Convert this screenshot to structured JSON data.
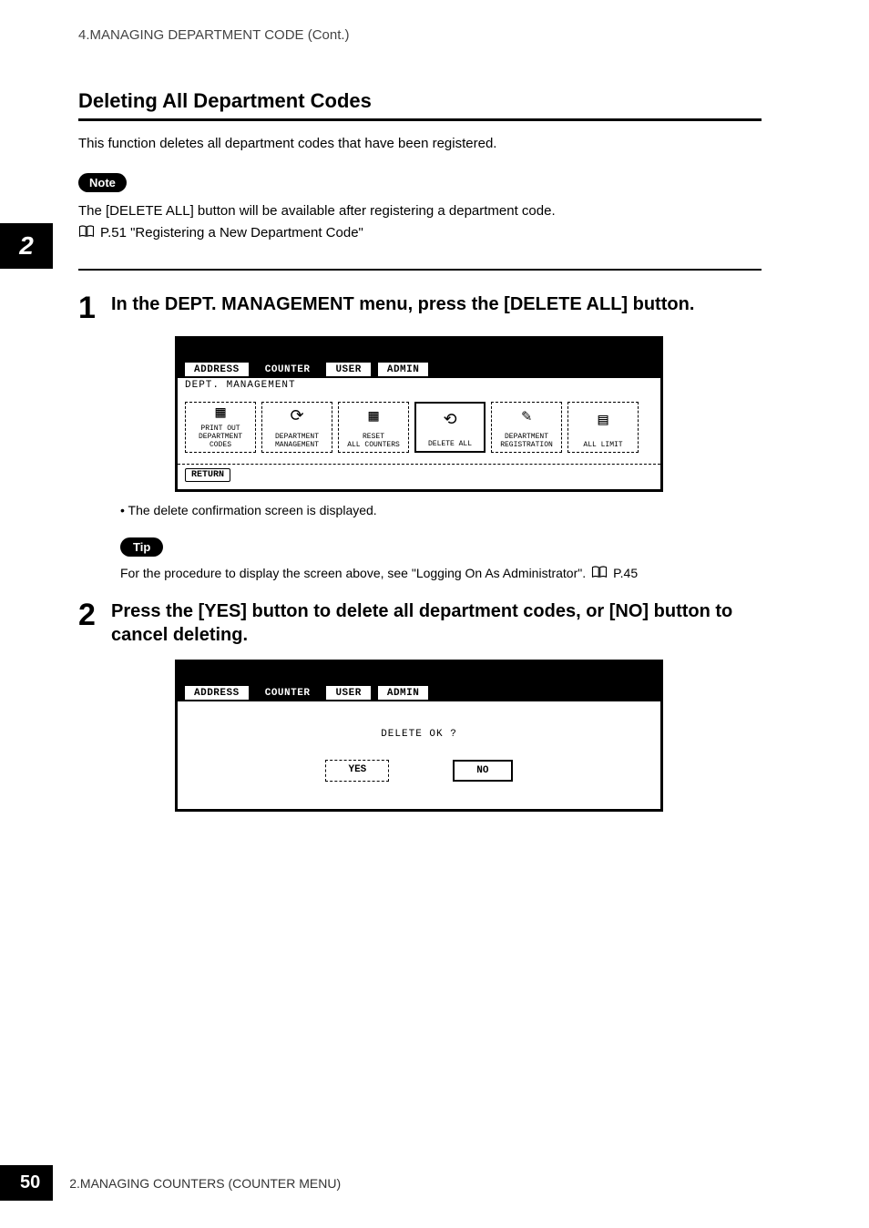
{
  "header": {
    "breadcrumb": "4.MANAGING DEPARTMENT CODE (Cont.)"
  },
  "side_tab": "2",
  "section": {
    "title": "Deleting All Department Codes",
    "intro": "This function deletes all department codes that have been registered."
  },
  "note": {
    "label": "Note",
    "line1": "The [DELETE ALL] button will be available after registering a department code.",
    "ref": "P.51 \"Registering a New Department Code\""
  },
  "steps": {
    "s1": {
      "num": "1",
      "title": "In the DEPT. MANAGEMENT menu, press the [DELETE ALL] button.",
      "bullet": "The delete confirmation screen is displayed."
    },
    "s2": {
      "num": "2",
      "title": "Press the [YES] button to delete all department codes, or [NO] button to cancel deleting."
    }
  },
  "tip": {
    "label": "Tip",
    "text": "For the procedure to display the screen above, see \"Logging On As Administrator\".",
    "ref": "P.45"
  },
  "ui1": {
    "tabs": {
      "address": "ADDRESS",
      "counter": "COUNTER",
      "user": "USER",
      "admin": "ADMIN"
    },
    "breadcrumb": "DEPT. MANAGEMENT",
    "buttons": {
      "b1a": "PRINT OUT",
      "b1b": "DEPARTMENT CODES",
      "b2a": "DEPARTMENT",
      "b2b": "MANAGEMENT",
      "b3a": "RESET",
      "b3b": "ALL COUNTERS",
      "b4": "DELETE ALL",
      "b5a": "DEPARTMENT",
      "b5b": "REGISTRATION",
      "b6": "ALL LIMIT"
    },
    "return": "RETURN"
  },
  "ui2": {
    "tabs": {
      "address": "ADDRESS",
      "counter": "COUNTER",
      "user": "USER",
      "admin": "ADMIN"
    },
    "question": "DELETE OK ?",
    "yes": "YES",
    "no": "NO"
  },
  "footer": {
    "page": "50",
    "text": "2.MANAGING COUNTERS (COUNTER MENU)"
  }
}
